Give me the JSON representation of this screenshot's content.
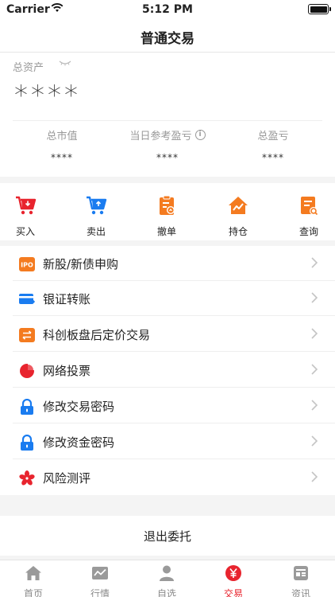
{
  "status_bar": {
    "carrier": "Carrier",
    "time": "5:12 PM"
  },
  "nav": {
    "title": "普通交易"
  },
  "assets": {
    "label": "总资产",
    "total": "****",
    "stats": [
      {
        "label": "总市值",
        "value": "****"
      },
      {
        "label": "当日参考盈亏",
        "value": "****"
      },
      {
        "label": "总盈亏",
        "value": "****"
      }
    ]
  },
  "actions": [
    {
      "label": "买入",
      "icon": "cart-in-icon"
    },
    {
      "label": "卖出",
      "icon": "cart-out-icon"
    },
    {
      "label": "撤单",
      "icon": "clipboard-icon"
    },
    {
      "label": "持仓",
      "icon": "house-chart-icon"
    },
    {
      "label": "查询",
      "icon": "search-doc-icon"
    }
  ],
  "menu": [
    {
      "label": "新股/新债申购",
      "icon": "ipo-icon"
    },
    {
      "label": "银证转账",
      "icon": "card-transfer-icon"
    },
    {
      "label": "科创板盘后定价交易",
      "icon": "exchange-icon"
    },
    {
      "label": "网络投票",
      "icon": "pie-icon"
    },
    {
      "label": "修改交易密码",
      "icon": "lock-icon"
    },
    {
      "label": "修改资金密码",
      "icon": "lock-icon"
    },
    {
      "label": "风险测评",
      "icon": "flower-icon"
    }
  ],
  "ipo_badge": "IPO",
  "logout": {
    "label": "退出委托"
  },
  "tabs": [
    {
      "label": "首页",
      "icon": "home-icon"
    },
    {
      "label": "行情",
      "icon": "chart-icon"
    },
    {
      "label": "自选",
      "icon": "person-icon"
    },
    {
      "label": "交易",
      "icon": "yen-icon"
    },
    {
      "label": "资讯",
      "icon": "news-icon"
    }
  ],
  "colors": {
    "accent": "#e8242e",
    "blue": "#1a7cf0",
    "orange": "#f47b20"
  }
}
